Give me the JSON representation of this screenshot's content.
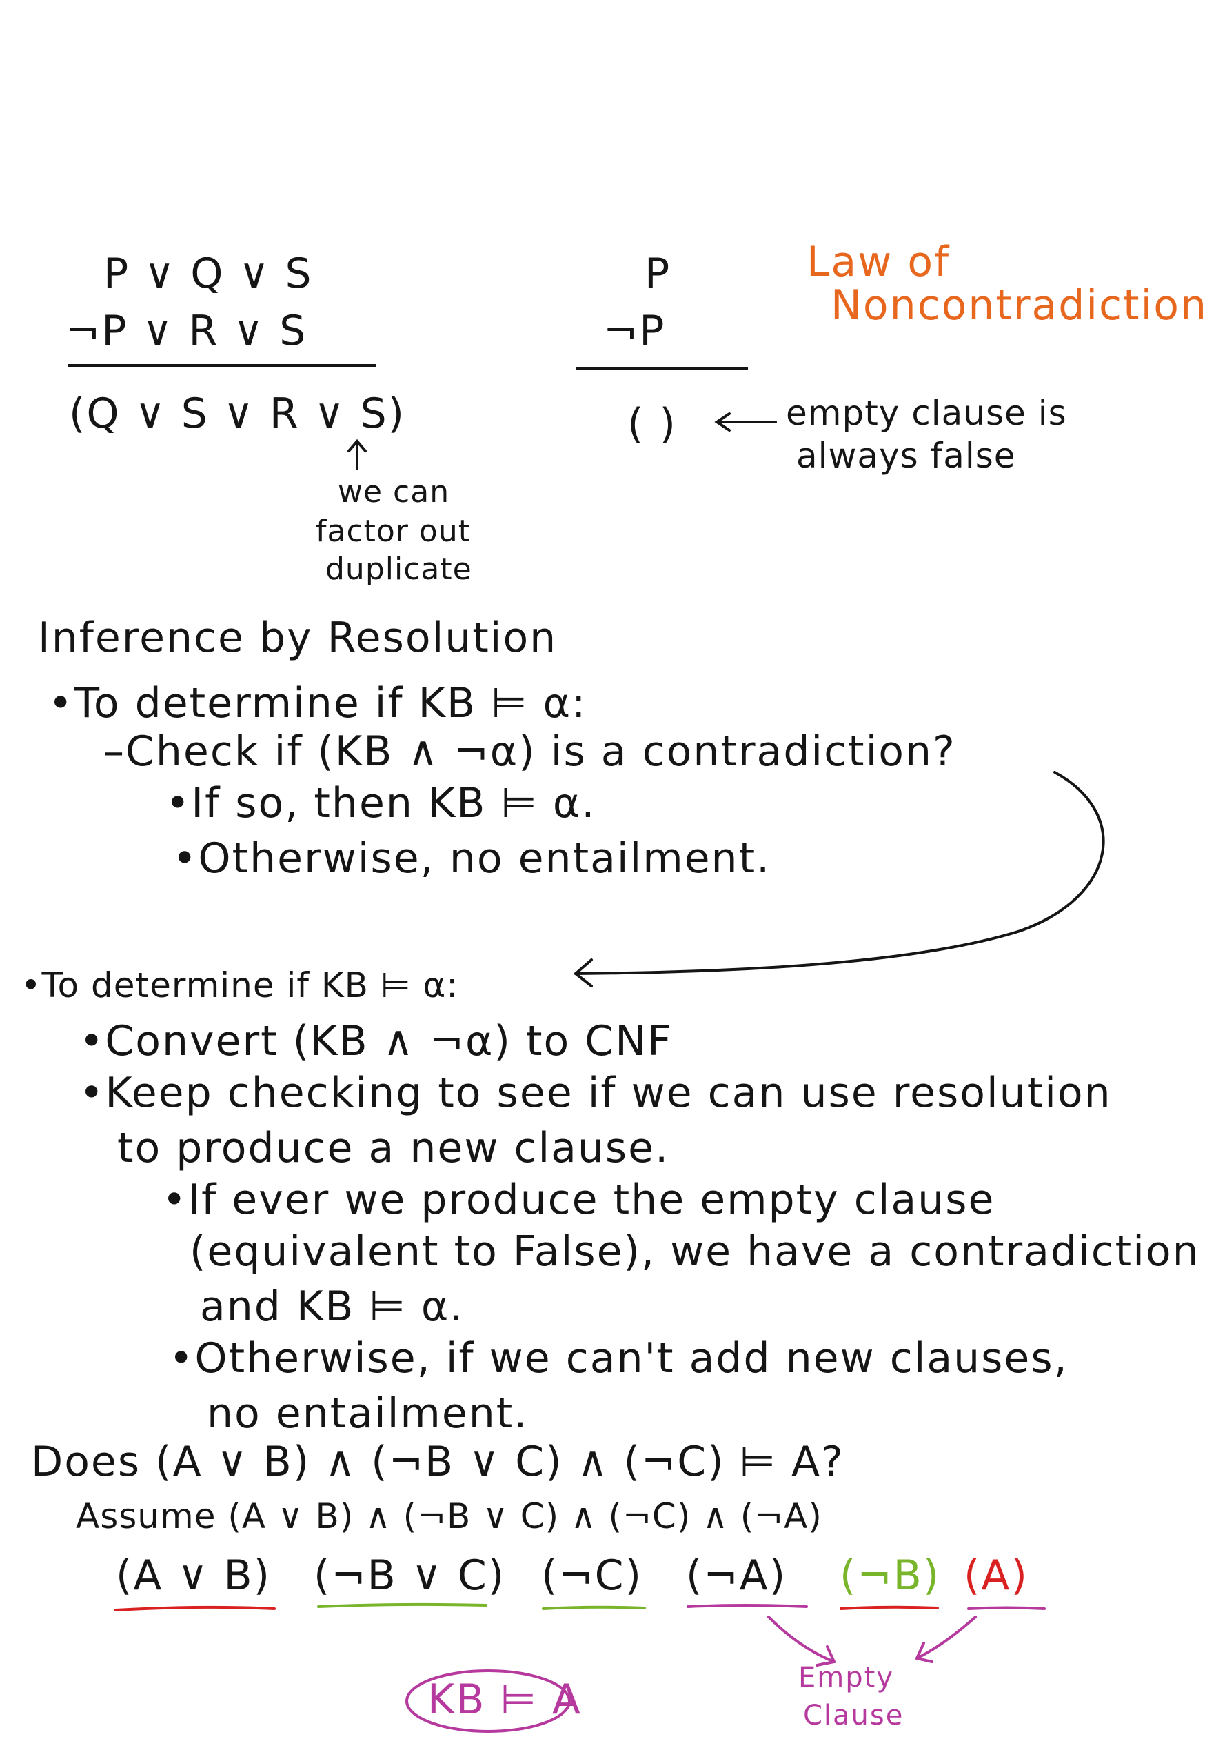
{
  "examples": {
    "left": {
      "line1": "P ∨ Q ∨ S",
      "line2": "¬P ∨ R ∨ S",
      "result": "(Q ∨ S ∨ R ∨ S)",
      "note_line1": "we can",
      "note_line2": "factor out",
      "note_line3": "duplicate"
    },
    "right": {
      "line1": "P",
      "line2": "¬P",
      "result": "( )",
      "note_line1": "empty clause is",
      "note_line2": "always false",
      "title_line1": "Law of",
      "title_line2": "Noncontradiction"
    }
  },
  "section1": {
    "heading": "Inference by Resolution",
    "bullet": "•To determine if KB ⊨ α:",
    "sub": "–Check if (KB ∧ ¬α) is a contradiction?",
    "subsub1": "•If so, then KB ⊨ α.",
    "subsub2": "•Otherwise, no entailment."
  },
  "section2": {
    "bullet": "•To determine if KB ⊨ α:",
    "item1": "•Convert (KB ∧ ¬α) to CNF",
    "item2_line1": "•Keep checking to see if we can use resolution",
    "item2_line2": "to produce a new clause.",
    "sub1_line1": "•If ever we produce the empty clause",
    "sub1_line2": "(equivalent to False), we have a contradiction",
    "sub1_line3": "and KB ⊨ α.",
    "sub2_line1": "•Otherwise, if we can't add new clauses,",
    "sub2_line2": "no entailment."
  },
  "example": {
    "question": "Does (A ∨ B) ∧ (¬B ∨ C) ∧ (¬C) ⊨ A?",
    "assume": "Assume (A ∨ B) ∧ (¬B ∨ C) ∧ (¬C) ∧ (¬A)",
    "clauses": [
      "(A ∨ B)",
      "(¬B ∨ C)",
      "(¬C)",
      "(¬A)",
      "(¬B)",
      "(A)"
    ],
    "conclusion": "KB ⊨ A",
    "empty_line1": "Empty",
    "empty_line2": "Clause"
  },
  "colors": {
    "ink": "#151515",
    "orange": "#e8671f",
    "red": "#d92121",
    "green": "#78b52b",
    "purple": "#b63a9e"
  }
}
